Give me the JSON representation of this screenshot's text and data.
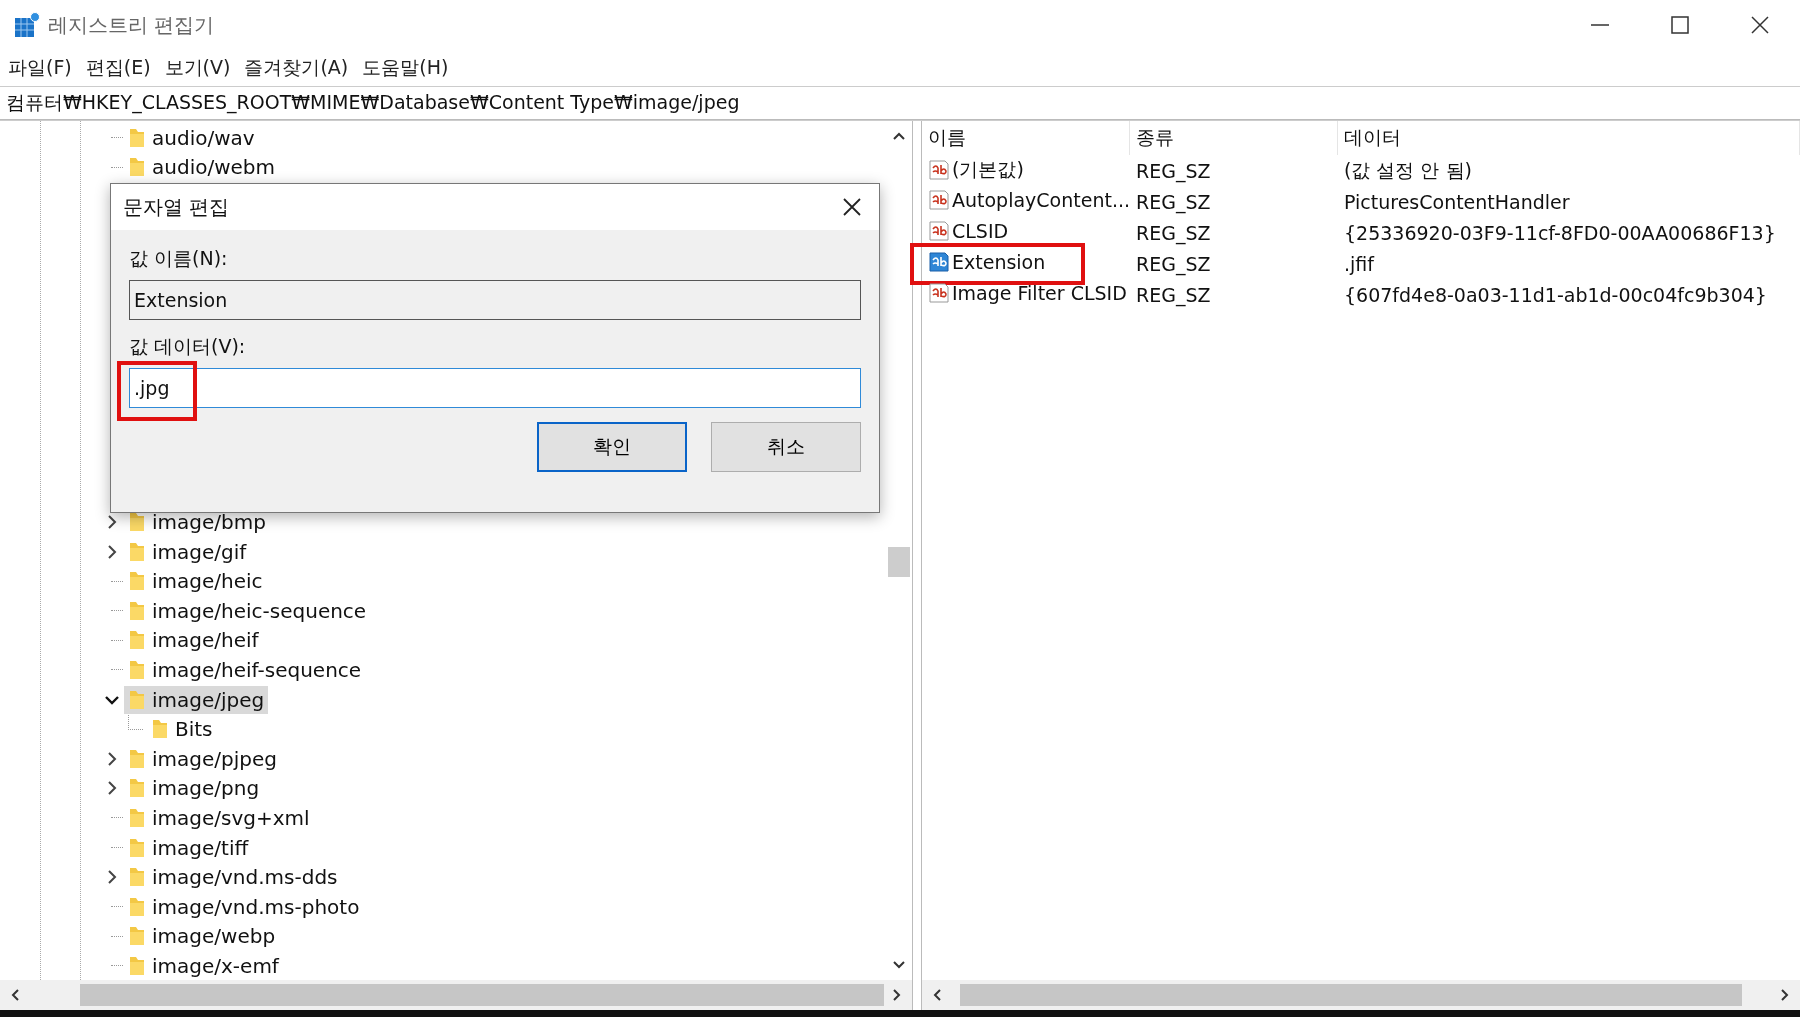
{
  "window": {
    "title": "레지스트리 편집기"
  },
  "menu": [
    "파일(F)",
    "편집(E)",
    "보기(V)",
    "즐겨찾기(A)",
    "도움말(H)"
  ],
  "address": "컴퓨터₩HKEY_CLASSES_ROOT₩MIME₩Database₩Content Type₩image/jpeg",
  "tree": {
    "items": [
      {
        "label": "audio/wav",
        "has_children": false,
        "selected": false
      },
      {
        "label": "audio/webm",
        "has_children": false,
        "selected": false
      },
      {
        "label": "image/bmp",
        "has_children": true,
        "expanded": false,
        "selected": false
      },
      {
        "label": "image/gif",
        "has_children": true,
        "expanded": false,
        "selected": false
      },
      {
        "label": "image/heic",
        "has_children": false,
        "selected": false
      },
      {
        "label": "image/heic-sequence",
        "has_children": false,
        "selected": false
      },
      {
        "label": "image/heif",
        "has_children": false,
        "selected": false
      },
      {
        "label": "image/heif-sequence",
        "has_children": false,
        "selected": false
      },
      {
        "label": "image/jpeg",
        "has_children": true,
        "expanded": true,
        "selected": true,
        "children": [
          {
            "label": "Bits",
            "selected": false
          }
        ]
      },
      {
        "label": "image/pjpeg",
        "has_children": true,
        "expanded": false,
        "selected": false
      },
      {
        "label": "image/png",
        "has_children": true,
        "expanded": false,
        "selected": false
      },
      {
        "label": "image/svg+xml",
        "has_children": false,
        "selected": false
      },
      {
        "label": "image/tiff",
        "has_children": false,
        "selected": false
      },
      {
        "label": "image/vnd.ms-dds",
        "has_children": true,
        "expanded": false,
        "selected": false
      },
      {
        "label": "image/vnd.ms-photo",
        "has_children": false,
        "selected": false
      },
      {
        "label": "image/webp",
        "has_children": false,
        "selected": false
      },
      {
        "label": "image/x-emf",
        "has_children": false,
        "selected": false
      }
    ]
  },
  "values": {
    "columns": [
      "이름",
      "종류",
      "데이터"
    ],
    "rows": [
      {
        "name": "(기본값)",
        "type": "REG_SZ",
        "data": "(값 설정 안 됨)",
        "selected": false,
        "annotated": false
      },
      {
        "name": "AutoplayContent...",
        "type": "REG_SZ",
        "data": "PicturesContentHandler",
        "selected": false,
        "annotated": false
      },
      {
        "name": "CLSID",
        "type": "REG_SZ",
        "data": "{25336920-03F9-11cf-8FD0-00AA00686F13}",
        "selected": false,
        "annotated": false
      },
      {
        "name": "Extension",
        "type": "REG_SZ",
        "data": ".jfif",
        "selected": true,
        "annotated": true
      },
      {
        "name": "Image Filter CLSID",
        "type": "REG_SZ",
        "data": "{607fd4e8-0a03-11d1-ab1d-00c04fc9b304}",
        "selected": false,
        "annotated": false
      }
    ]
  },
  "dialog": {
    "title": "문자열 편집",
    "name_label": "값 이름(N):",
    "name_value": "Extension",
    "data_label": "값 데이터(V):",
    "data_value": ".jpg",
    "data_annotated": true,
    "buttons": [
      {
        "label": "확인",
        "default": true
      },
      {
        "label": "취소",
        "default": false
      }
    ]
  }
}
